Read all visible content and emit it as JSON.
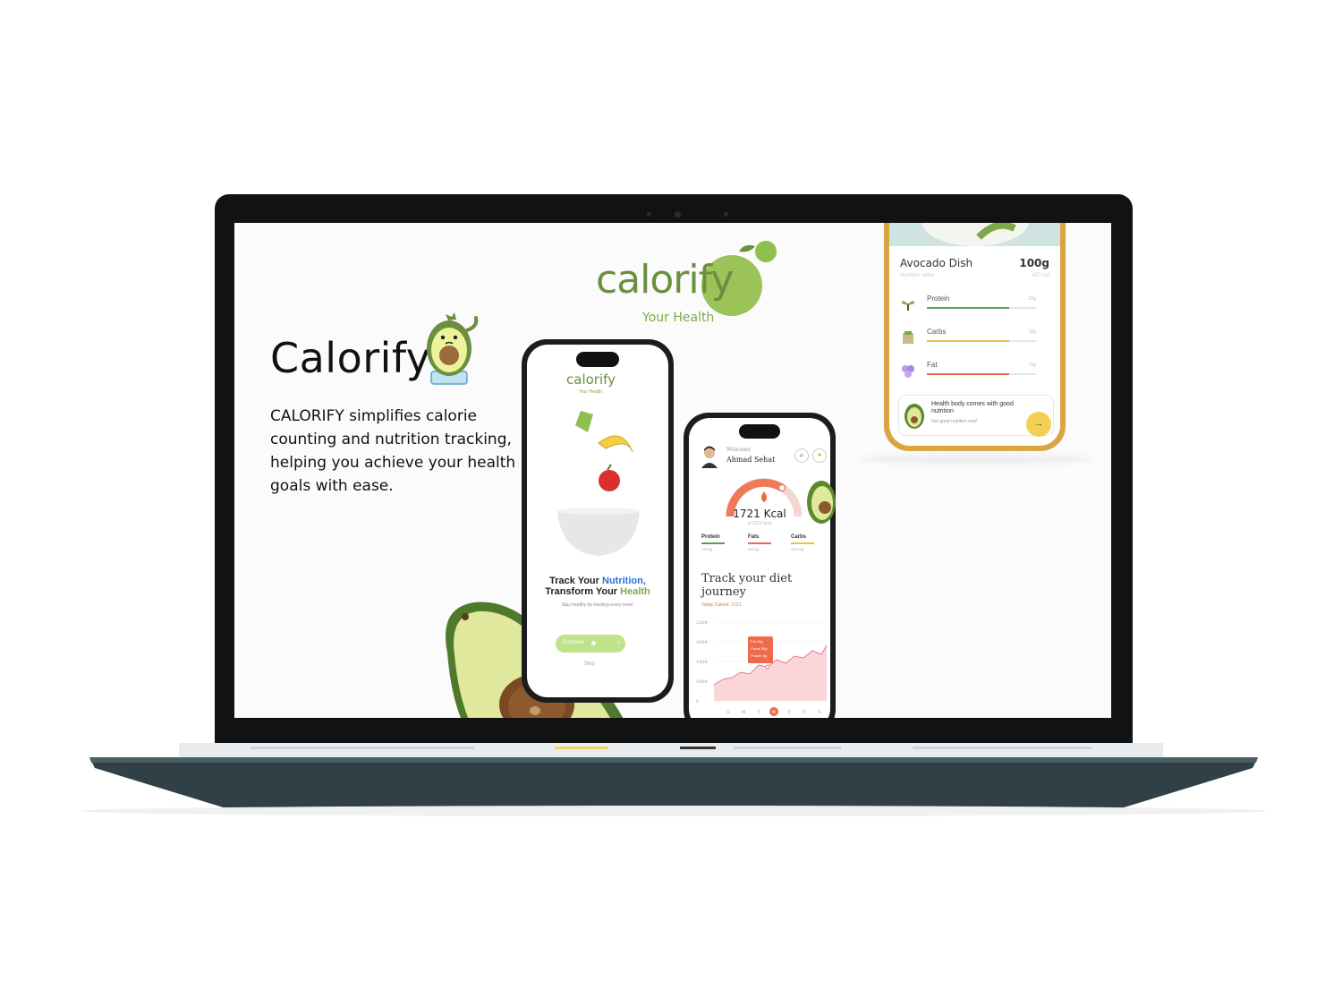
{
  "hero": {
    "title": "Calorify",
    "description": "CALORIFY simplifies calorie counting and nutrition tracking, helping you achieve your health goals with ease."
  },
  "brand": {
    "word": "calorify",
    "tagline": "Your Health"
  },
  "phone_onboarding": {
    "logo_word": "calorify",
    "logo_tagline": "Your Health",
    "headline_part1": "Track Your",
    "headline_accent1": "Nutrition,",
    "headline_part2": "Transform Your",
    "headline_accent2": "Health",
    "subtext": "Stay healthy by tracking every meal.",
    "continue_label": "Continue",
    "skip_label": "Skip"
  },
  "phone_dashboard": {
    "welcome_label": "Welcome",
    "user_name": "Ahmad Sehat",
    "calories_value": "1721 Kcal",
    "calories_goal": "of 2213 kcal",
    "macros": [
      {
        "label": "Protein",
        "value": "78/90g",
        "color": "#5aa05a"
      },
      {
        "label": "Fats",
        "value": "45/70g",
        "color": "#e56b4e"
      },
      {
        "label": "Carbs",
        "value": "95/110g",
        "color": "#e8c24a"
      }
    ],
    "journey_title": "Track your diet journey",
    "today_calories": "Today Calorie: 1721",
    "tooltip_lines": [
      "Fat 40g",
      "Carbs 30g",
      "Protein 8g"
    ],
    "y_ticks": [
      "2500",
      "2000",
      "1500",
      "1000",
      "0"
    ],
    "x_days": [
      "S",
      "M",
      "T",
      "W",
      "T",
      "F",
      "S"
    ]
  },
  "phone_dish": {
    "dish_name": "Avocado Dish",
    "dish_weight": "100g",
    "sub_label": "Nutrition value",
    "sub_value": "457 cal",
    "nutrients": [
      {
        "label": "Protein",
        "value": "22g",
        "color": "#5aa05a",
        "icon": "sprout-icon"
      },
      {
        "label": "Carbs",
        "value": "18g",
        "color": "#e8c24a",
        "icon": "grain-icon"
      },
      {
        "label": "Fat",
        "value": "19g",
        "color": "#e56b4e",
        "icon": "berries-icon"
      }
    ],
    "promo_title": "Health body comes with good nutrition",
    "promo_sub": "Get good nutrition now!"
  },
  "colors": {
    "brand_green": "#6b8f3e",
    "accent_blue": "#2f6fd6",
    "accent_green": "#7ea94a",
    "accent_orange": "#e56b4e",
    "accent_yellow": "#f3cf55"
  }
}
